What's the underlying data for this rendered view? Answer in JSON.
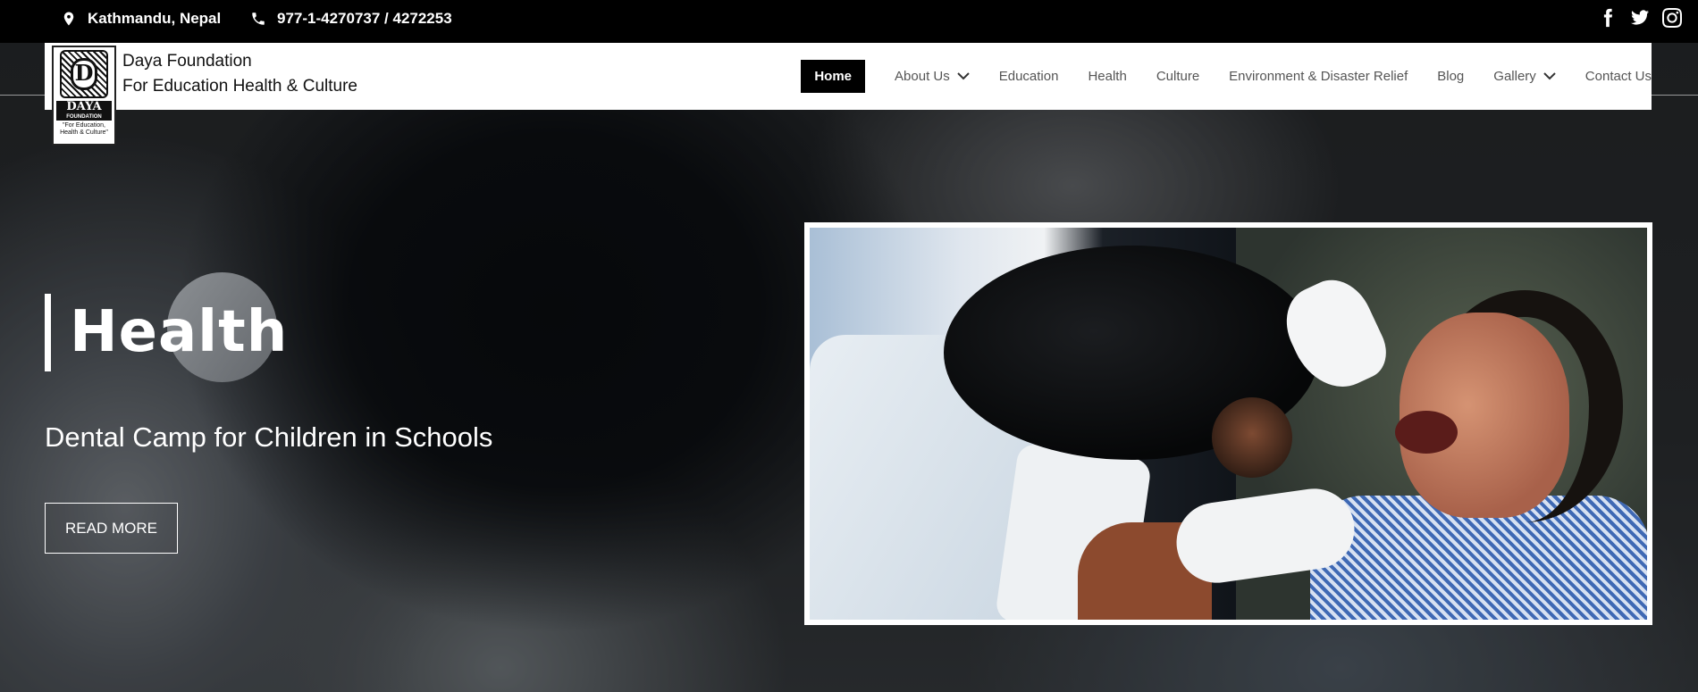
{
  "topbar": {
    "location": "Kathmandu, Nepal",
    "phone": "977-1-4270737 / 4272253",
    "social": [
      "facebook-icon",
      "twitter-icon",
      "instagram-icon"
    ]
  },
  "header": {
    "brand_line1": "Daya Foundation",
    "brand_line2": "For Education Health & Culture",
    "logo": {
      "letter": "D",
      "name": "DAYA",
      "sub": "FOUNDATION",
      "tagline": "\"For Education, Health & Culture\""
    }
  },
  "nav": {
    "items": [
      {
        "label": "Home",
        "active": true
      },
      {
        "label": "About Us",
        "dropdown": true
      },
      {
        "label": "Education"
      },
      {
        "label": "Health"
      },
      {
        "label": "Culture"
      },
      {
        "label": "Environment & Disaster Relief"
      },
      {
        "label": "Blog"
      },
      {
        "label": "Gallery",
        "dropdown": true
      },
      {
        "label": "Contact Us"
      }
    ]
  },
  "hero": {
    "category": "Health",
    "title": "Dental Camp for Children in Schools",
    "button": "READ MORE"
  },
  "colors": {
    "topbar": "#000000",
    "navbar": "#ffffff",
    "active_nav": "#000000"
  }
}
